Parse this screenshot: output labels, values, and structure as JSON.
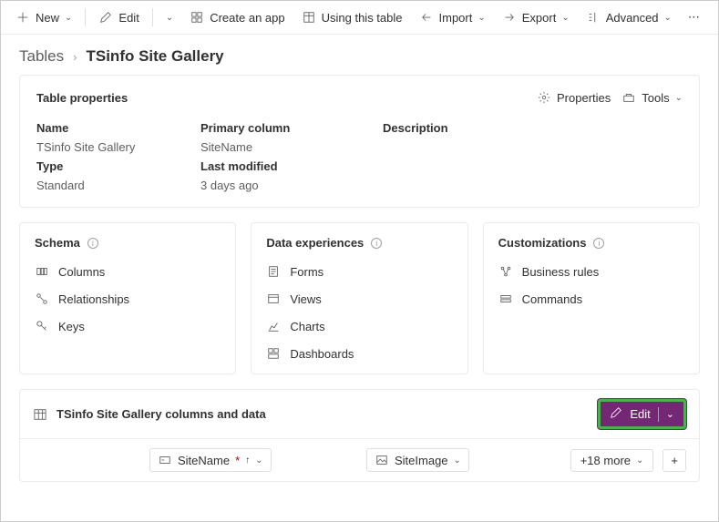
{
  "toolbar": {
    "new_label": "New",
    "edit_label": "Edit",
    "create_app_label": "Create an app",
    "using_table_label": "Using this table",
    "import_label": "Import",
    "export_label": "Export",
    "advanced_label": "Advanced",
    "overflow_label": "⋯"
  },
  "breadcrumb": {
    "root": "Tables",
    "current": "TSinfo Site Gallery"
  },
  "properties": {
    "card_title": "Table properties",
    "properties_btn": "Properties",
    "tools_btn": "Tools",
    "labels": {
      "name": "Name",
      "primary_column": "Primary column",
      "description": "Description",
      "type": "Type",
      "last_modified": "Last modified"
    },
    "values": {
      "name": "TSinfo Site Gallery",
      "primary_column": "SiteName",
      "description": "",
      "type": "Standard",
      "last_modified": "3 days ago"
    }
  },
  "schema": {
    "title": "Schema",
    "items": [
      "Columns",
      "Relationships",
      "Keys"
    ]
  },
  "data_experiences": {
    "title": "Data experiences",
    "items": [
      "Forms",
      "Views",
      "Charts",
      "Dashboards"
    ]
  },
  "customizations": {
    "title": "Customizations",
    "items": [
      "Business rules",
      "Commands"
    ]
  },
  "data_grid": {
    "title": "TSinfo Site Gallery columns and data",
    "edit_btn": "Edit",
    "columns": [
      {
        "label": "SiteName",
        "required": true,
        "sort": "up"
      },
      {
        "label": "SiteImage",
        "required": false,
        "sort": null
      }
    ],
    "more_cols": "+18 more"
  }
}
